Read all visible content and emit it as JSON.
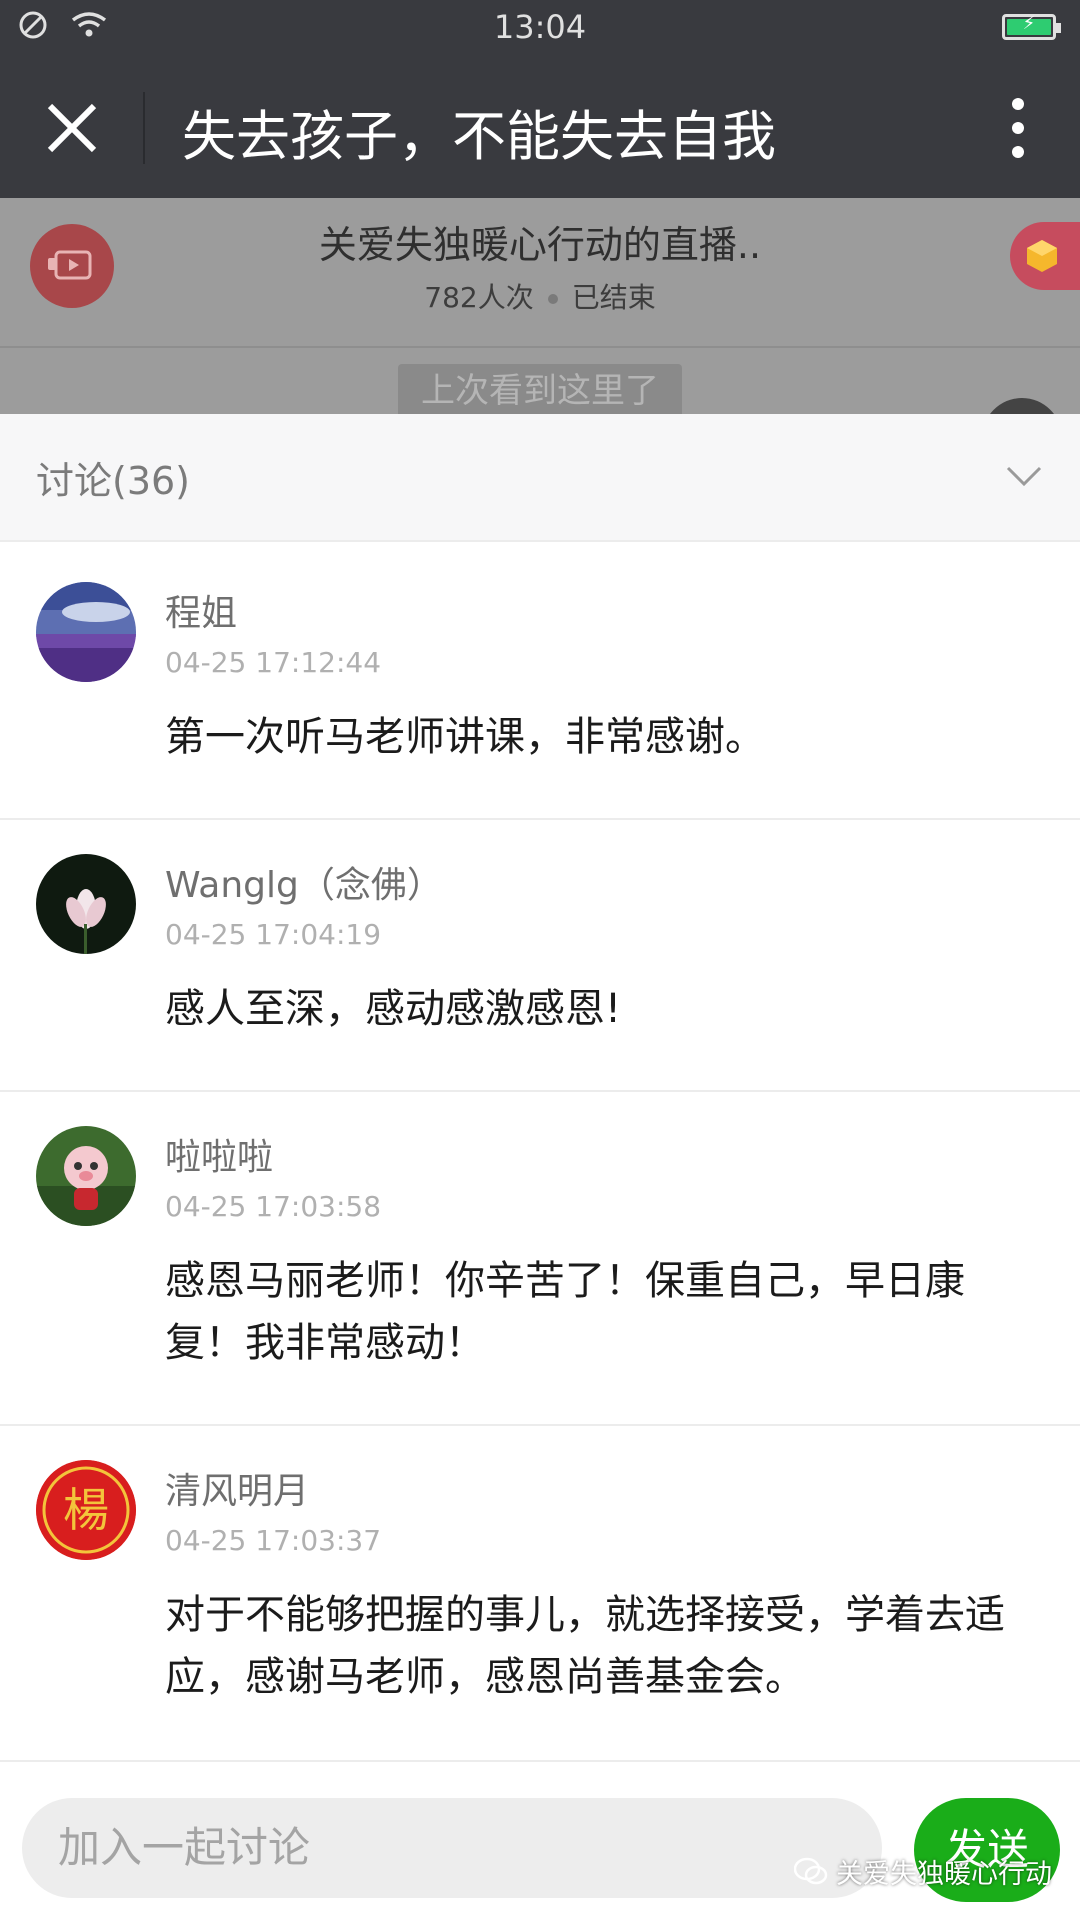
{
  "status_bar": {
    "time": "13:04",
    "icons": [
      "no-disturb-icon",
      "wifi-icon",
      "battery-charging-icon"
    ]
  },
  "title_bar": {
    "title": "失去孩子，不能失去自我",
    "close_icon": "close-icon",
    "more_icon": "more-vertical-icon"
  },
  "live": {
    "title": "关爱失独暖心行动的直播..",
    "views": "782人次",
    "status": "已结束",
    "last_seen": "上次看到这里了"
  },
  "discussion": {
    "header": "讨论(36)",
    "comments": [
      {
        "name": "程姐",
        "time": "04-25 17:12:44",
        "text": "第一次听马老师讲课，非常感谢。"
      },
      {
        "name": "Wanglg（念佛）",
        "time": "04-25 17:04:19",
        "text": "感人至深，感动感激感恩!"
      },
      {
        "name": "啦啦啦",
        "time": "04-25 17:03:58",
        "text": "感恩马丽老师！你辛苦了！保重自己，早日康复！我非常感动！"
      },
      {
        "name": "清风明月",
        "time": "04-25 17:03:37",
        "text": "对于不能够把握的事儿，就选择接受，学着去适应，感谢马老师，感恩尚善基金会。",
        "avatar_text": "楊"
      }
    ]
  },
  "input": {
    "placeholder": "加入一起讨论",
    "send_label": "发送"
  },
  "watermark": "关爱失独暖心行动",
  "colors": {
    "bar_bg": "#393a3f",
    "send_green": "#1aad19",
    "overlay_gray": "#9c9c9c"
  }
}
